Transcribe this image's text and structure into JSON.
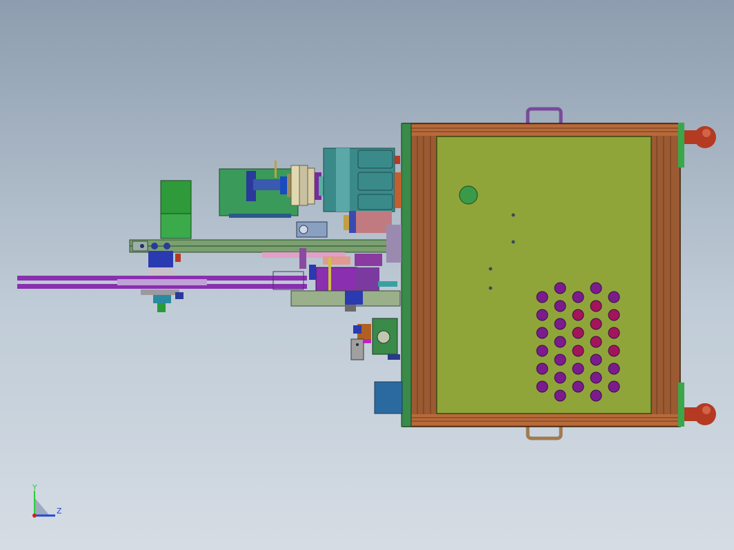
{
  "view": {
    "background_top": "#8d9daf",
    "background_bottom": "#d5dce4"
  },
  "triad": {
    "y_label": "Y",
    "z_label": "Z",
    "y_color": "#2ecc40",
    "z_color": "#2346d8",
    "origin_color": "#d12020"
  },
  "palette": {
    "frame_wood": "#a0582e",
    "frame_wood_dark": "#6e3a1c",
    "panel": "#8fa53a",
    "panel_stroke": "#3a4a10",
    "hole_purple": "#7b1c8c",
    "hole_magenta": "#a3155a",
    "handle": "#8a5ca8",
    "knob": "#b43a22",
    "motor_green": "#2f9a3a",
    "spindle_teal": "#3a8a8a",
    "slide_purple": "#8a2fb0",
    "rail_green": "#7aa070"
  },
  "icons": [
    "coordinate-triad-icon"
  ]
}
